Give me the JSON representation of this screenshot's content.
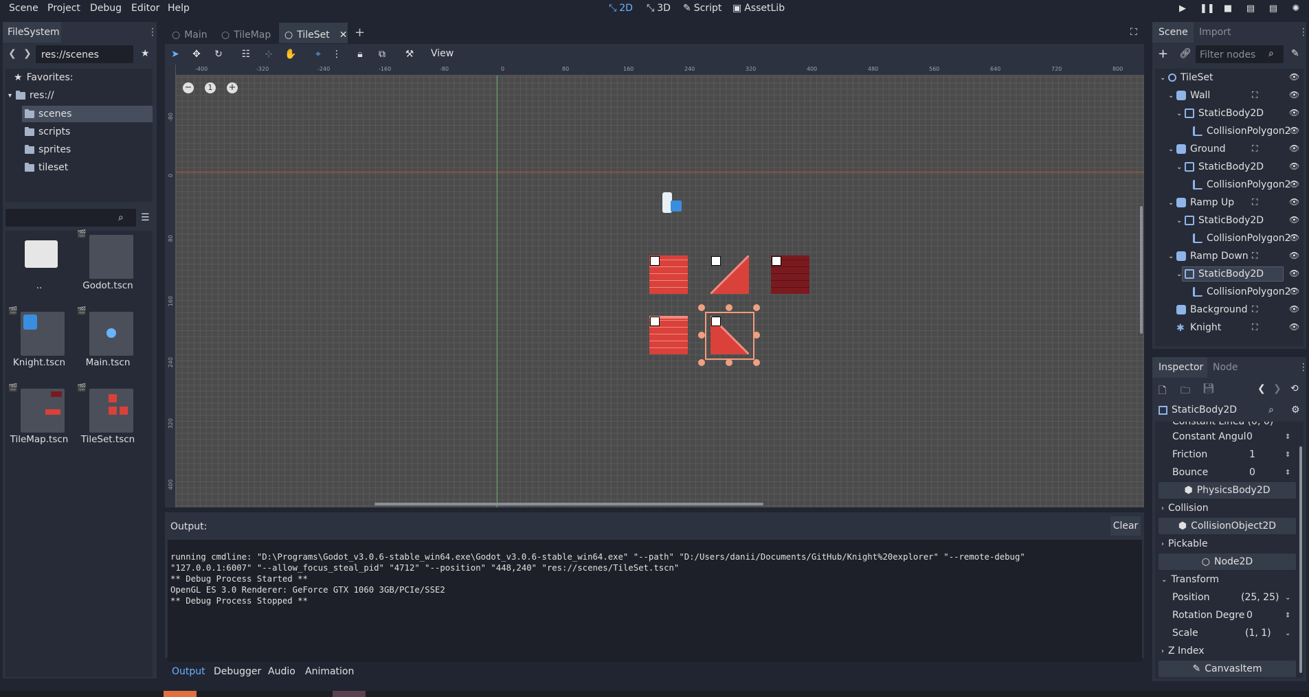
{
  "menu": [
    "Scene",
    "Project",
    "Debug",
    "Editor",
    "Help"
  ],
  "workspaces": [
    {
      "label": "2D",
      "active": true
    },
    {
      "label": "3D"
    },
    {
      "label": "Script"
    },
    {
      "label": "AssetLib"
    }
  ],
  "filesystem": {
    "tab": "FileSystem",
    "path": "res://scenes",
    "tree": [
      {
        "label": "Favorites:"
      },
      {
        "label": "res://"
      },
      {
        "label": "scenes",
        "selected": true
      },
      {
        "label": "scripts"
      },
      {
        "label": "sprites"
      },
      {
        "label": "tileset"
      }
    ],
    "files": [
      {
        "label": ".."
      },
      {
        "label": "Godot.tscn"
      },
      {
        "label": "Knight.tscn"
      },
      {
        "label": "Main.tscn"
      },
      {
        "label": "TileMap.tscn"
      },
      {
        "label": "TileSet.tscn"
      }
    ]
  },
  "scene_tabs": [
    {
      "label": "Main"
    },
    {
      "label": "TileMap"
    },
    {
      "label": "TileSet",
      "active": true
    }
  ],
  "toolbar": {
    "view_label": "View"
  },
  "ruler_top": [
    "-400",
    "-320",
    "-240",
    "-160",
    "-80",
    "0",
    "80",
    "160",
    "240",
    "320",
    "400",
    "480",
    "560",
    "640",
    "720",
    "800"
  ],
  "ruler_left": [
    "-80",
    "0",
    "80",
    "160",
    "240",
    "320",
    "400"
  ],
  "scene_dock": {
    "tabs": [
      "Scene",
      "Import"
    ],
    "filter_placeholder": "Filter nodes",
    "nodes": [
      {
        "label": "TileSet",
        "depth": 0
      },
      {
        "label": "Wall",
        "depth": 1
      },
      {
        "label": "StaticBody2D",
        "depth": 2
      },
      {
        "label": "CollisionPolygon2",
        "depth": 3
      },
      {
        "label": "Ground",
        "depth": 1
      },
      {
        "label": "StaticBody2D",
        "depth": 2
      },
      {
        "label": "CollisionPolygon2",
        "depth": 3
      },
      {
        "label": "Ramp Up",
        "depth": 1
      },
      {
        "label": "StaticBody2D",
        "depth": 2
      },
      {
        "label": "CollisionPolygon2",
        "depth": 3
      },
      {
        "label": "Ramp Down",
        "depth": 1
      },
      {
        "label": "StaticBody2D",
        "depth": 2,
        "selected": true
      },
      {
        "label": "CollisionPolygon2",
        "depth": 3
      },
      {
        "label": "Background",
        "depth": 1
      },
      {
        "label": "Knight",
        "depth": 1
      }
    ]
  },
  "inspector": {
    "tabs": [
      "Inspector",
      "Node"
    ],
    "object": "StaticBody2D",
    "cut_row": "Constant Linea (0, 0)",
    "props": [
      {
        "label": "Constant Angul",
        "value": "0"
      },
      {
        "label": "Friction",
        "value": "1"
      },
      {
        "label": "Bounce",
        "value": "0"
      }
    ],
    "sections": [
      "PhysicsBody2D",
      "CollisionObject2D",
      "Node2D",
      "CanvasItem"
    ],
    "groups": [
      "Collision",
      "Pickable",
      "Transform",
      "Z Index"
    ],
    "transform": [
      {
        "label": "Position",
        "value": "(25, 25)"
      },
      {
        "label": "Rotation Degre",
        "value": "0"
      },
      {
        "label": "Scale",
        "value": "(1, 1)"
      }
    ]
  },
  "output": {
    "label": "Output:",
    "clear": "Clear",
    "lines": [
      "running cmdline: \"D:\\Programs\\Godot_v3.0.6-stable_win64.exe\\Godot_v3.0.6-stable_win64.exe\" \"--path\" \"D:/Users/danii/Documents/GitHub/Knight%20explorer\" \"--remote-debug\"",
      "\"127.0.0.1:6007\" \"--allow_focus_steal_pid\" \"4712\" \"--position\" \"448,240\" \"res://scenes/TileSet.tscn\"",
      "** Debug Process Started **",
      "OpenGL ES 3.0 Renderer: GeForce GTX 1060 3GB/PCIe/SSE2",
      "** Debug Process Stopped **"
    ]
  },
  "bottom_tabs": [
    {
      "label": "Output",
      "active": true
    },
    {
      "label": "Debugger"
    },
    {
      "label": "Audio"
    },
    {
      "label": "Animation"
    }
  ],
  "colors": {
    "accent": "#6ab3ff",
    "brick": "#d9413a",
    "brick_dark": "#7a1a1f"
  }
}
